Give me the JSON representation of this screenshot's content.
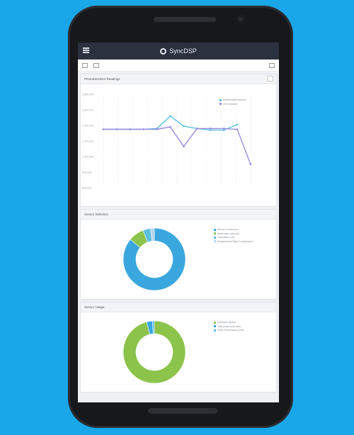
{
  "app": {
    "title": "SyncDSP"
  },
  "cards": {
    "line": {
      "title": "Phototransistor Readings",
      "legend": [
        {
          "label": "Ambient light detector",
          "color": "#5bc0de"
        },
        {
          "label": "LED indicator",
          "color": "#9b8ce0"
        }
      ]
    },
    "donut1": {
      "title": "Sensor Selection",
      "legend": [
        {
          "label": "Sensor of reference",
          "color": "#3aa7df"
        },
        {
          "label": "Illumination selected",
          "color": "#8cc34b"
        },
        {
          "label": "Calibration Cost",
          "color": "#5bc0de"
        },
        {
          "label": "Measurement Ratio Consumption",
          "color": "#b6d3ee"
        }
      ]
    },
    "donut2": {
      "title": "Sensor Usage",
      "legend": [
        {
          "label": "Hardware Uptime",
          "color": "#8cc34b"
        },
        {
          "label": "Total peak hours used",
          "color": "#3aa7df"
        },
        {
          "label": "Peak Performance Mode",
          "color": "#5bc0de"
        }
      ]
    }
  },
  "chart_data": [
    {
      "type": "line",
      "y_ticks": [
        "1,800,000",
        "1,600,000",
        "1,400,000",
        "1,200,000",
        "1,000,000",
        "800,000",
        "600,000"
      ],
      "x_count": 11,
      "series": [
        {
          "name": "Ambient light detector",
          "color": "#5bc0de",
          "values": [
            1350000,
            1350000,
            1350000,
            1350000,
            1360000,
            1520000,
            1390000,
            1360000,
            1340000,
            1340000,
            1410000
          ]
        },
        {
          "name": "LED indicator",
          "color": "#9b8ce0",
          "values": [
            1350000,
            1350000,
            1350000,
            1350000,
            1350000,
            1380000,
            1130000,
            1360000,
            1360000,
            1360000,
            1350000,
            900000
          ]
        }
      ],
      "ylim": [
        600000,
        1800000
      ]
    },
    {
      "type": "pie",
      "donut": true,
      "slices": [
        {
          "label": "Sensor of reference",
          "value": 86,
          "color": "#3aa7df"
        },
        {
          "label": "Illumination selected",
          "value": 8,
          "color": "#8cc34b"
        },
        {
          "label": "Calibration Cost",
          "value": 4,
          "color": "#5bc0de"
        },
        {
          "label": "Measurement Ratio Consumption",
          "value": 2,
          "color": "#b6d3ee"
        }
      ]
    },
    {
      "type": "pie",
      "donut": true,
      "slices": [
        {
          "label": "Hardware Uptime",
          "value": 96,
          "color": "#8cc34b"
        },
        {
          "label": "Total peak hours used",
          "value": 3,
          "color": "#3aa7df"
        },
        {
          "label": "Peak Performance Mode",
          "value": 1,
          "color": "#5bc0de"
        }
      ]
    }
  ]
}
